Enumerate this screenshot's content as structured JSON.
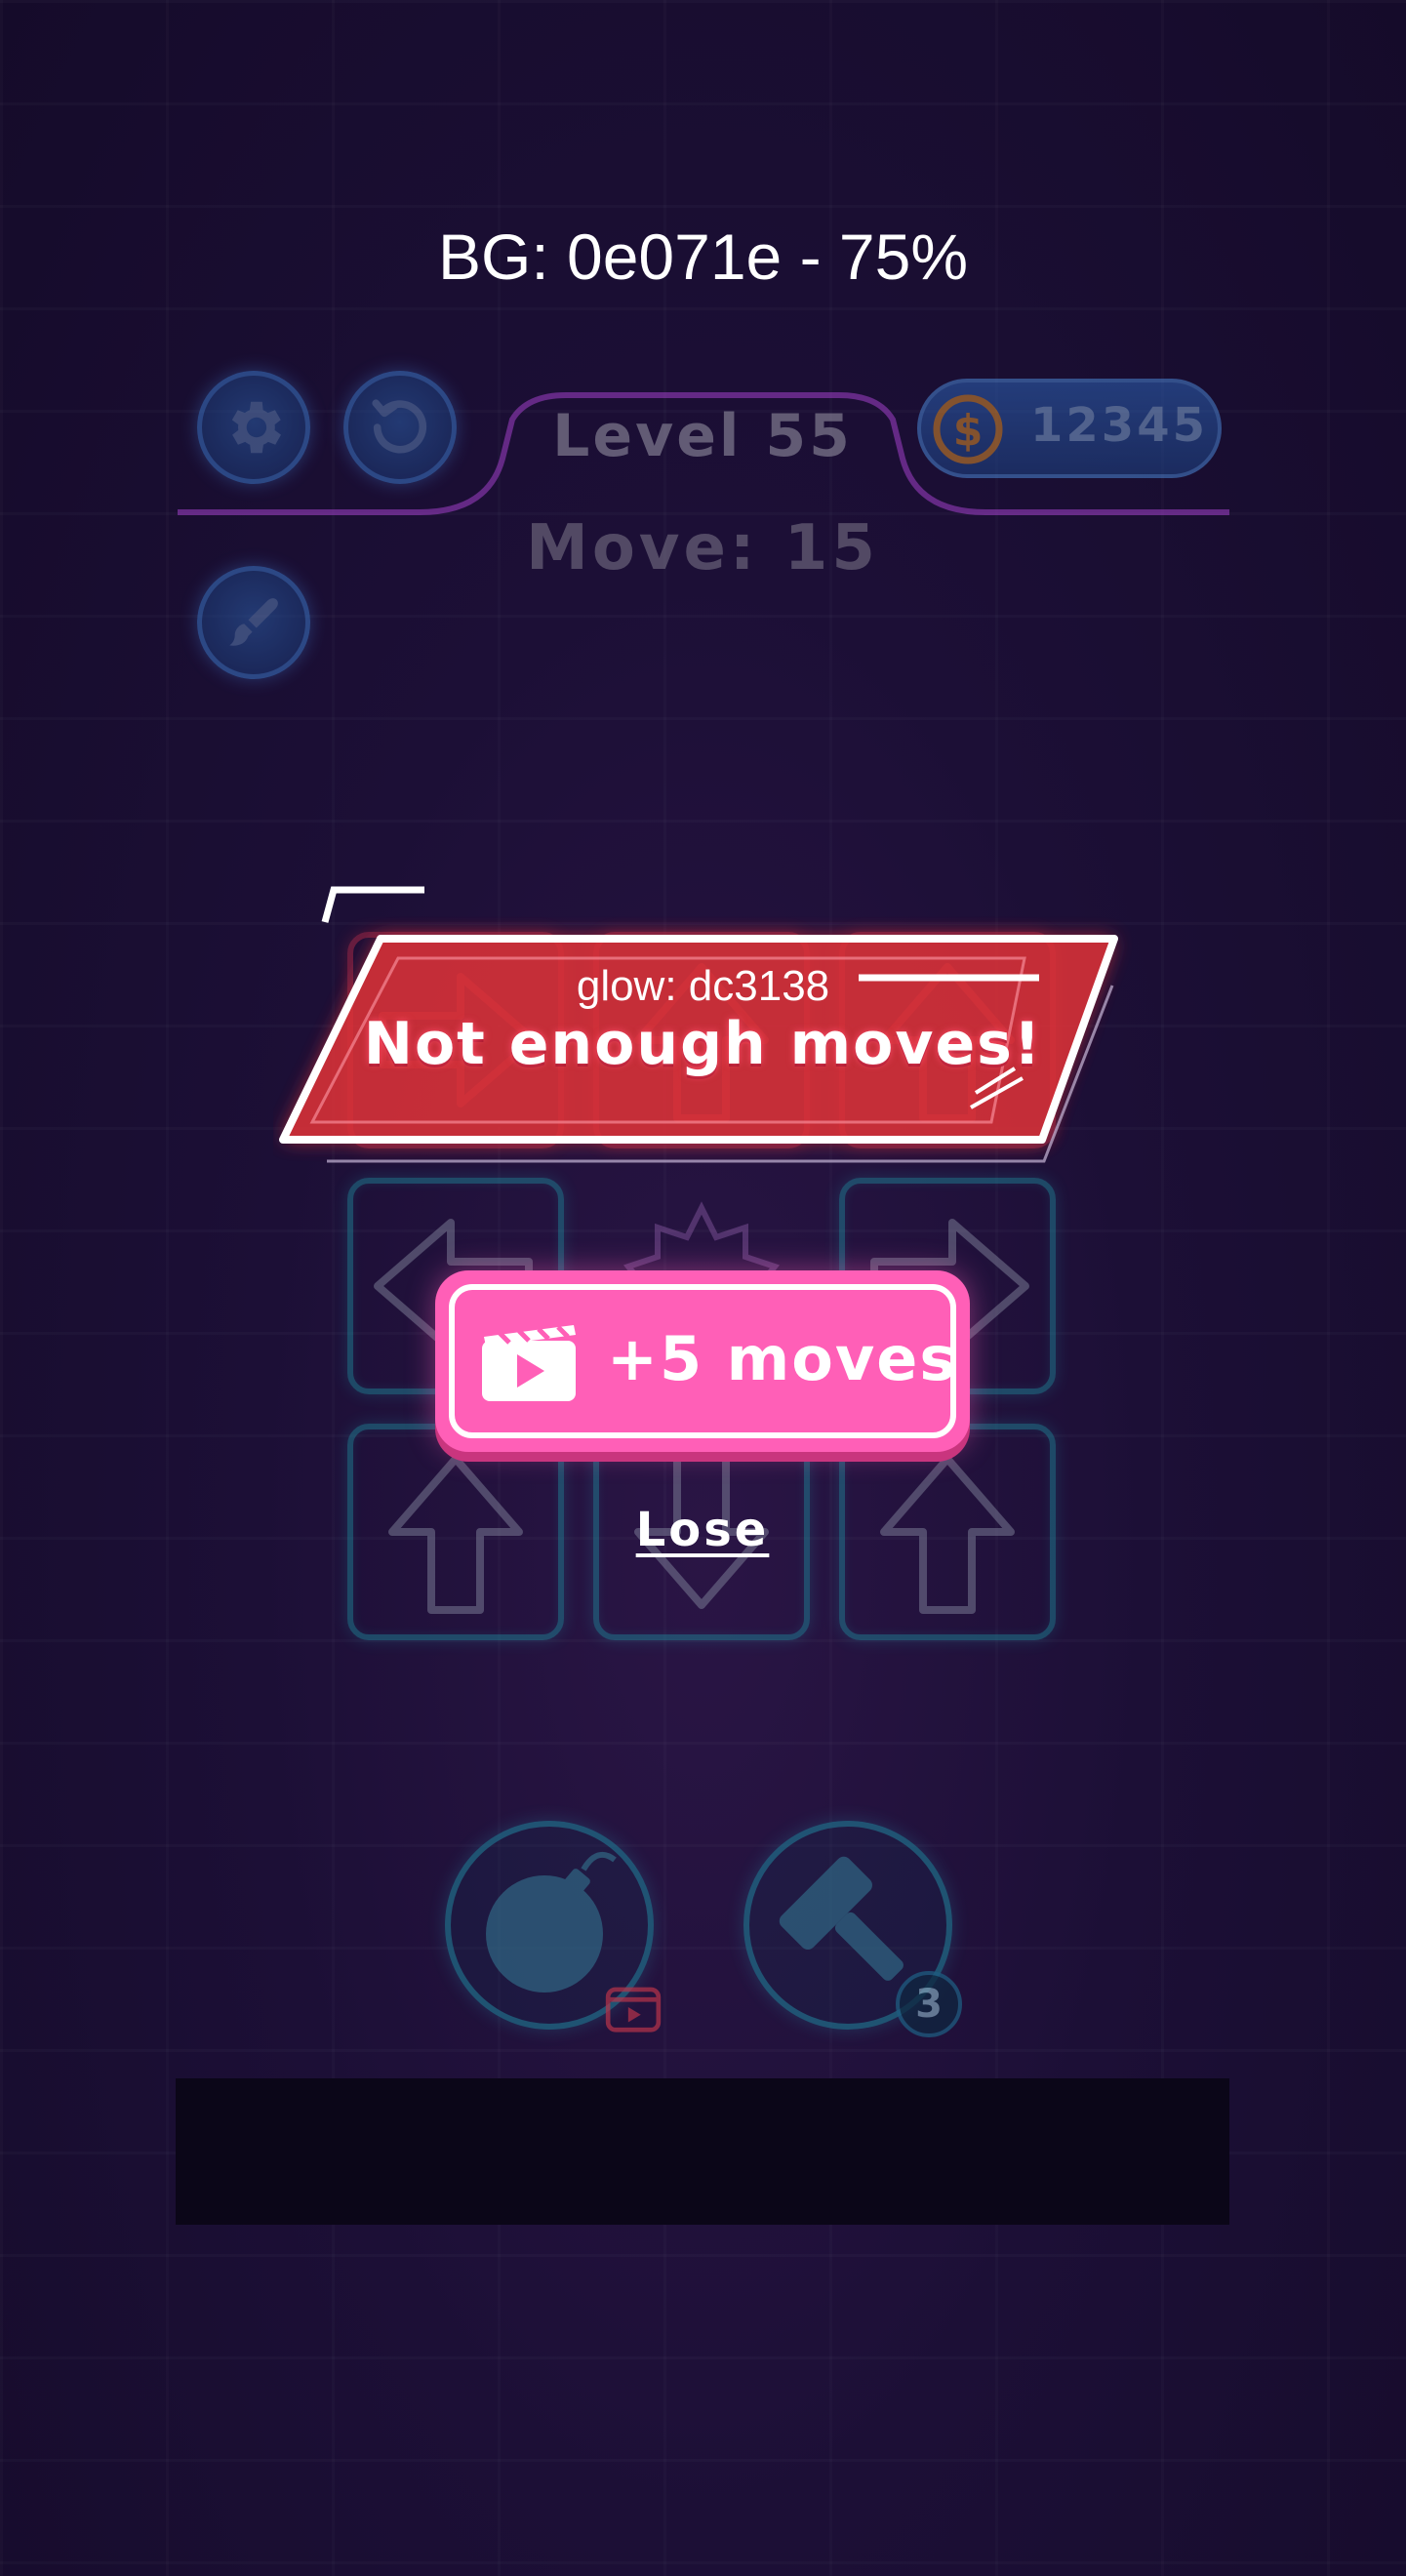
{
  "debug": {
    "bg_label": "BG: 0e071e  - 75%",
    "glow_label": "glow: dc3138"
  },
  "hud": {
    "level": "Level 55",
    "move": "Move:  15",
    "coins": "12345"
  },
  "popup": {
    "title": "Not enough moves!",
    "add_moves_label": "+5 moves",
    "lose_label": "Lose"
  },
  "boosters": {
    "hammer_count": "3"
  },
  "colors": {
    "background": "#0e071e",
    "glow": "#dc3138",
    "button": "#ff5fb7"
  }
}
